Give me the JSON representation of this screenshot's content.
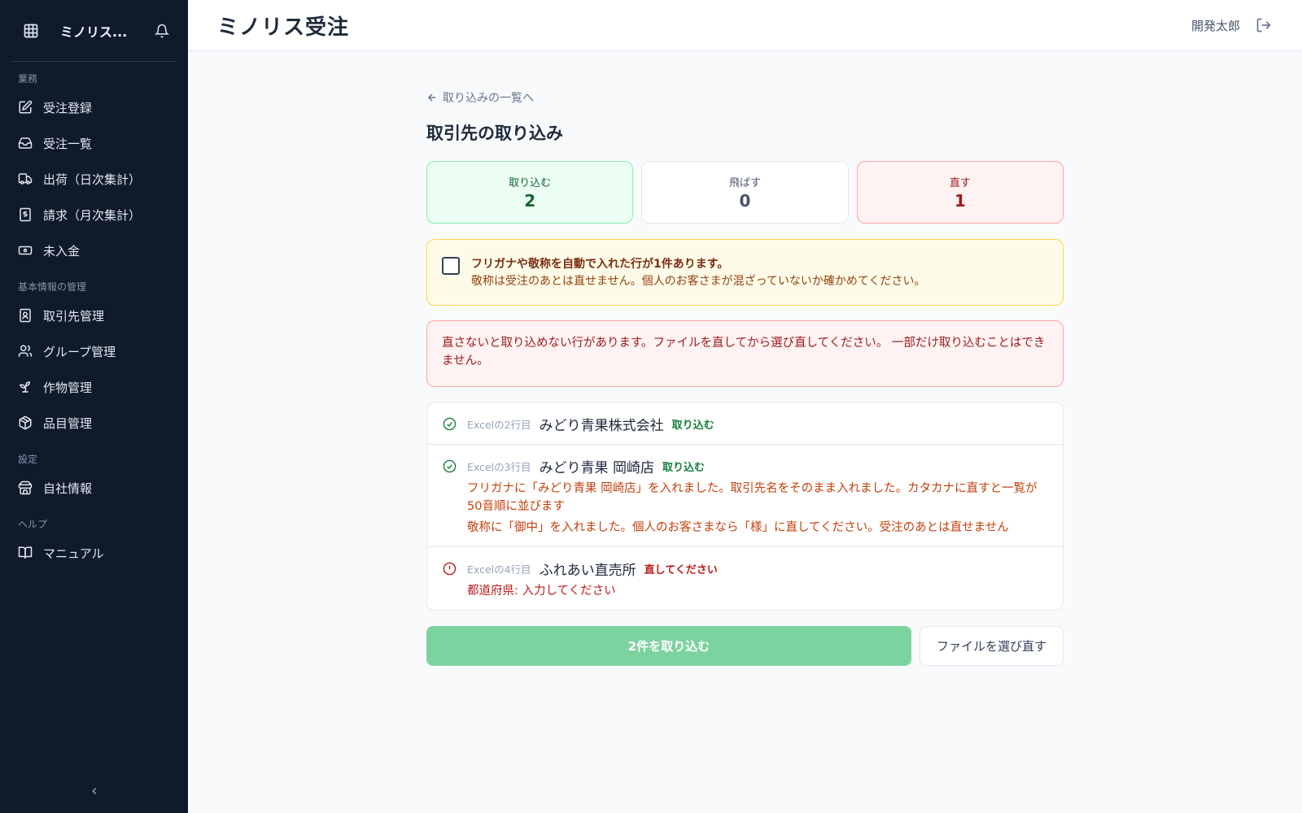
{
  "sidebar": {
    "app_name": "ミノリス...",
    "sections": [
      {
        "label": "業務"
      },
      {
        "label": "基本情報の管理"
      },
      {
        "label": "設定"
      },
      {
        "label": "ヘルプ"
      }
    ],
    "items": [
      {
        "label": "受注登録",
        "icon": "edit-icon"
      },
      {
        "label": "受注一覧",
        "icon": "inbox-icon"
      },
      {
        "label": "出荷（日次集計）",
        "icon": "truck-icon"
      },
      {
        "label": "請求（月次集計）",
        "icon": "invoice-icon"
      },
      {
        "label": "未入金",
        "icon": "banknote-icon"
      },
      {
        "label": "取引先管理",
        "icon": "contact-icon"
      },
      {
        "label": "グループ管理",
        "icon": "users-icon"
      },
      {
        "label": "作物管理",
        "icon": "sprout-icon"
      },
      {
        "label": "品目管理",
        "icon": "package-icon"
      },
      {
        "label": "自社情報",
        "icon": "store-icon"
      },
      {
        "label": "マニュアル",
        "icon": "book-icon"
      }
    ]
  },
  "header": {
    "title": "ミノリス受注",
    "user": "開発太郎"
  },
  "main": {
    "back_label": "取り込みの一覧へ",
    "page_title": "取引先の取り込み",
    "stats": {
      "import": {
        "label": "取り込む",
        "value": "2"
      },
      "skip": {
        "label": "飛ばす",
        "value": "0"
      },
      "fix": {
        "label": "直す",
        "value": "1"
      }
    },
    "warning": {
      "title": "フリガナや敬称を自動で入れた行が1件あります。",
      "body": "敬称は受注のあとは直せません。個人のお客さまが混ざっていないか確かめてください。"
    },
    "error_message": "直さないと取り込めない行があります。ファイルを直してから選び直してください。 一部だけ取り込むことはできません。",
    "rows": [
      {
        "source": "Excelの2行目",
        "name": "みどり青果株式会社",
        "status": "取り込む"
      },
      {
        "source": "Excelの3行目",
        "name": "みどり青果 岡崎店",
        "status": "取り込む",
        "messages": [
          "フリガナに「みどり青果 岡崎店」を入れました。取引先名をそのまま入れました。カタカナに直すと一覧が50音順に並びます",
          "敬称に「御中」を入れました。個人のお客さまなら「様」に直してください。受注のあとは直せません"
        ]
      },
      {
        "source": "Excelの4行目",
        "name": "ふれあい直売所",
        "status": "直してください",
        "messages": [
          "都道府県: 入力してください"
        ]
      }
    ],
    "import_button": "2件を取り込む",
    "reselect_button": "ファイルを選び直す"
  },
  "colors": {
    "sidebar_bg": "#0f1a2b",
    "ok_green": "#15803d",
    "error_red": "#b91c1c",
    "warning_orange": "#c2410c",
    "primary_button_disabled": "#7dd3a0"
  }
}
